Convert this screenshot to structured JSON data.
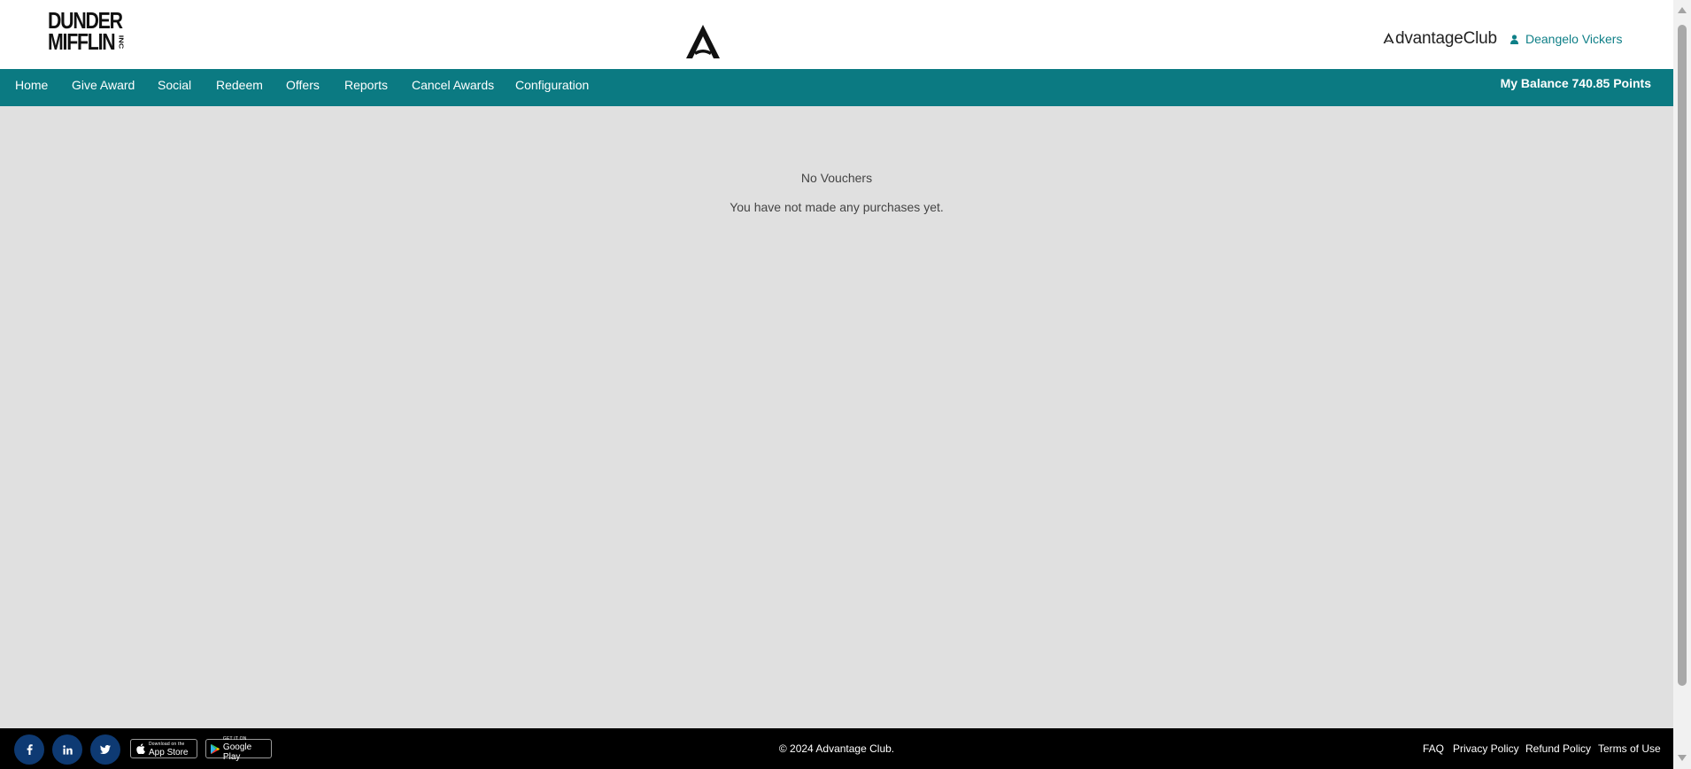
{
  "header": {
    "logo": {
      "line1": "DUNDER",
      "line2": "MIFFLIN",
      "suffix": "INC"
    },
    "center_mark_icon": "advantage-a-logo",
    "brand": {
      "text": "dvantageClub",
      "icon": "advantage-a-glyph"
    },
    "user": {
      "name": "Deangelo Vickers",
      "icon": "user-icon"
    }
  },
  "nav": {
    "items": [
      "Home",
      "Give Award",
      "Social",
      "Redeem",
      "Offers",
      "Reports",
      "Cancel Awards",
      "Configuration"
    ],
    "balance": "My Balance 740.85 Points"
  },
  "main": {
    "empty_title": "No Vouchers",
    "empty_desc": "You have not made any purchases yet."
  },
  "footer": {
    "social": [
      "facebook-icon",
      "linkedin-icon",
      "twitter-icon"
    ],
    "app_store": {
      "small": "Download on the",
      "big": "App Store"
    },
    "google_play": {
      "small": "GET IT ON",
      "big": "Google Play"
    },
    "copyright": "© 2024 Advantage Club.",
    "links": [
      "FAQ",
      "Privacy Policy",
      "Refund Policy",
      "Terms of Use"
    ]
  },
  "colors": {
    "nav_bg": "#0b7a82",
    "accent_text": "#0e7f87",
    "content_bg": "#e0e0e0",
    "footer_bg": "#000000",
    "social_bg": "#0e3a73"
  }
}
